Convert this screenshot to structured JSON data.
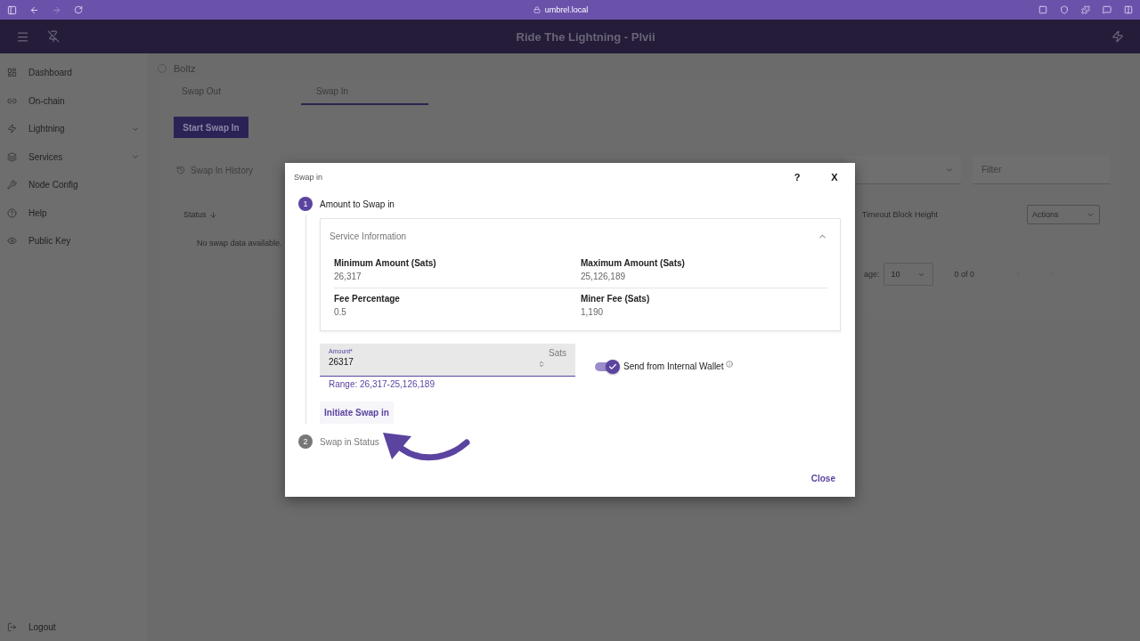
{
  "browser": {
    "url": "umbrel.local"
  },
  "app_bar": {
    "title": "Ride The Lightning - Plvii"
  },
  "sidebar": {
    "items": [
      {
        "label": "Dashboard",
        "kind": "dashboard",
        "expandable": false
      },
      {
        "label": "On-chain",
        "kind": "chain",
        "expandable": false
      },
      {
        "label": "Lightning",
        "kind": "bolt",
        "expandable": true
      },
      {
        "label": "Services",
        "kind": "stack",
        "expandable": true
      },
      {
        "label": "Node Config",
        "kind": "tools",
        "expandable": false
      },
      {
        "label": "Help",
        "kind": "help",
        "expandable": false
      },
      {
        "label": "Public Key",
        "kind": "eye",
        "expandable": false
      }
    ],
    "logout": "Logout"
  },
  "page": {
    "breadcrumb": "Boltz",
    "tabs": [
      {
        "label": "Swap Out",
        "selected": false
      },
      {
        "label": "Swap In",
        "selected": true
      }
    ],
    "start_button": "Start Swap In",
    "history_title": "Swap In History",
    "filter_field": {
      "placeholder": "Filter"
    },
    "table": {
      "columns": [
        "Status",
        "Timeout Block Height"
      ],
      "actions": "Actions",
      "empty": "No swap data available."
    },
    "paginator": {
      "label": "age:",
      "page_size": "10",
      "range": "0 of 0"
    }
  },
  "dialog": {
    "title": "Swap in",
    "help": "?",
    "close_icon": "X",
    "steps": [
      {
        "number": "1",
        "label": "Amount to Swap in",
        "active": true
      },
      {
        "number": "2",
        "label": "Swap in Status",
        "active": false
      }
    ],
    "service_info": {
      "title": "Service Information",
      "expanded": true,
      "fields": [
        {
          "label": "Minimum Amount (Sats)",
          "value": "26,317"
        },
        {
          "label": "Maximum Amount (Sats)",
          "value": "25,126,189"
        },
        {
          "label": "Fee Percentage",
          "value": "0.5"
        },
        {
          "label": "Miner Fee (Sats)",
          "value": "1,190"
        }
      ]
    },
    "amount": {
      "label": "Amount*",
      "value": "26317",
      "suffix": "Sats",
      "hint": "Range: 26,317-25,126,189"
    },
    "toggle": {
      "label": "Send from Internal Wallet",
      "on": true
    },
    "initiate_button": "Initiate Swap in",
    "close_button": "Close"
  }
}
